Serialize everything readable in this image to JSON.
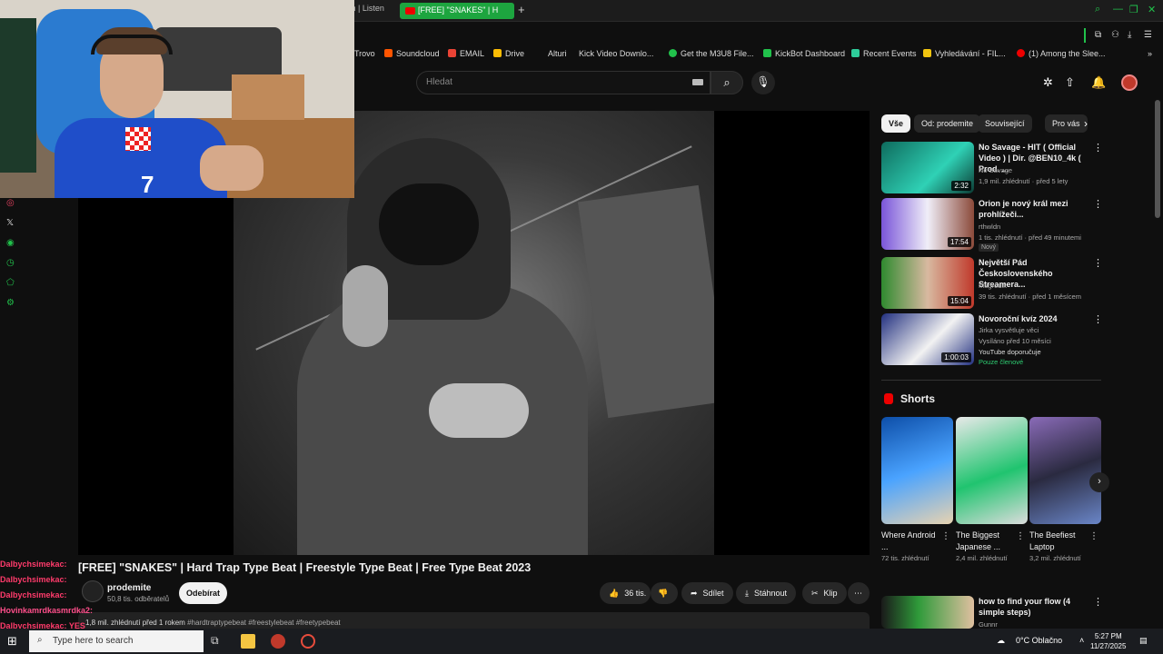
{
  "browser": {
    "prev_tab": "m | Listen",
    "active_tab": "[FREE] \"SNAKES\" | H",
    "bookmarks": [
      {
        "label": "Trovo",
        "color": "#21c14b"
      },
      {
        "label": "Soundcloud",
        "color": "#ff5500"
      },
      {
        "label": "EMAIL",
        "color": "#ea4335"
      },
      {
        "label": "Drive",
        "color": "#fbbc04"
      },
      {
        "label": "Alturi",
        "color": ""
      },
      {
        "label": "Kick Video Downlo...",
        "color": ""
      },
      {
        "label": "Get the M3U8 File...",
        "color": "#21c14b"
      },
      {
        "label": "KickBot Dashboard",
        "color": "#21c14b"
      },
      {
        "label": "Recent Events",
        "color": "#2ecc9a"
      },
      {
        "label": "Vyhledávání - FIL...",
        "color": "#f1c40f"
      },
      {
        "label": "(1) Among the Slee...",
        "color": "#e00"
      }
    ]
  },
  "youtube": {
    "search_placeholder": "Hledat",
    "video": {
      "title": "[FREE] \"SNAKES\" | Hard Trap Type Beat | Freestyle Type Beat | Free Type Beat 2023",
      "channel": "prodemite",
      "subscribers": "50,8 tis. odběratelů",
      "subscribe_label": "Odebírat",
      "likes": "36 tis.",
      "share_label": "Sdílet",
      "download_label": "Stáhnout",
      "clip_label": "Klip",
      "desc_meta": "1,8 mil. zhlédnutí  před 1 rokem",
      "desc_tags": "#hardtraptypebeat #freestylebeat #freetypebeat"
    },
    "chips": [
      "Vše",
      "Od: prodemite",
      "Související",
      "Pro vás"
    ],
    "recommendations": [
      {
        "title": "No Savage - HIT ( Official Video ) | Dir. @BEN10_4k ( Prod. ...",
        "channel": "No Savage",
        "meta": "1,9 mil. zhlédnutí · před 5 lety",
        "duration": "2:32",
        "badge": "",
        "thumb_color": "#1f9b8a"
      },
      {
        "title": "Orion je nový král mezi prohlížeči...",
        "channel": "rthwldn",
        "meta": "1 tis. zhlédnutí · před 49 minutemi",
        "duration": "17:54",
        "badge": "Nový",
        "thumb_color": "#6b4bc9"
      },
      {
        "title": "Největší Pád Československého Streamera...",
        "channel": "Magrodik",
        "meta": "39 tis. zhlédnutí · před 1 měsícem",
        "duration": "15:04",
        "badge": "",
        "thumb_color": "#3f7f3a"
      },
      {
        "title": "Novoroční kvíz 2024",
        "channel": "Jirka vysvětluje věci",
        "meta": "Vysíláno před 10 měsíci",
        "duration": "1:00:03",
        "badge": "",
        "extra": "YouTube doporučuje",
        "members": "Pouze členové",
        "thumb_color": "#2b3b8f"
      }
    ],
    "shorts_label": "Shorts",
    "shorts": [
      {
        "title": "Where Android ...",
        "views": "72 tis. zhlédnutí",
        "thumb_color": "#1e6fd9"
      },
      {
        "title": "The Biggest Japanese ...",
        "views": "2,4 mil. zhlédnutí",
        "thumb_color": "#1bb86a"
      },
      {
        "title": "The Beefiest Laptop",
        "views": "3,2 mil. zhlédnutí",
        "thumb_color": "#5a4a7a"
      }
    ],
    "bottom_rec": {
      "title": "how to find your flow (4 simple steps)",
      "channel": "Gunnr",
      "thumb_color": "#2f9a3a"
    }
  },
  "chat": [
    "Dalbychsimekac:",
    "Dalbychsimekac:",
    "Dalbychsimekac:",
    "Hovinkamrdkasmrdka2:",
    "Dalbychsimekac: YES"
  ],
  "webcam": {
    "jersey_number": "7"
  },
  "taskbar": {
    "search_placeholder": "Type here to search",
    "weather": "0°C  Oblačno",
    "time": "5:27 PM",
    "date": "11/27/2025"
  }
}
